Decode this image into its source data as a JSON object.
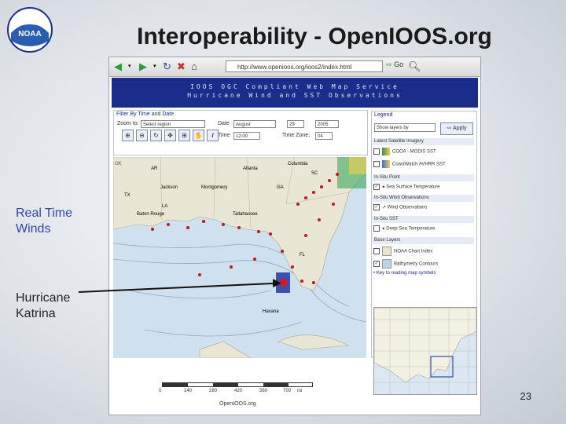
{
  "slide": {
    "title": "Interoperability - OpenIOOS.org",
    "label_winds": "Real Time Winds",
    "label_hurricane": "Hurricane Katrina",
    "slide_number": "23",
    "logo_text": "NOAA"
  },
  "browser": {
    "url": "http://www.openioos.org/ioos2/index.html",
    "go_label": "Go",
    "banner_line1": "IOOS OGC Compliant Web Map Service",
    "banner_line2": "Hurricane Wind and SST Observations",
    "filter_label": "Filter By Time and Date",
    "zoom_label": "Zoom to:",
    "zoom_value": "Select region",
    "date_label": "Date",
    "date_month": "August",
    "date_day": "29",
    "date_year": "2005",
    "time_label": "Time",
    "time_value": "12:00",
    "timezone_label": "Time Zone:",
    "timezone_value": "04",
    "legend_title": "Legend",
    "legend_select": "Show layers by",
    "apply_label": "Apply",
    "legend_sections": [
      {
        "title": "Latest Satellite Imagery",
        "items": [
          "COOA - MODIS SST",
          "CoastWatch AVHRR SST"
        ]
      },
      {
        "title": "In-Situ Point",
        "items": [
          "Sea Surface Temperature"
        ]
      },
      {
        "title": "In-Situ Wind Observations",
        "items": [
          "Wind Observations"
        ]
      },
      {
        "title": "In-Situ SST",
        "items": [
          "Deep Sea Temperature"
        ]
      },
      {
        "title": "Base Layers",
        "items": [
          "NOAA Chart Index",
          "Bathymetry Contours"
        ]
      }
    ],
    "legend_key_link": "Key to reading map symbols",
    "map_labels": [
      "AR",
      "Atlanta",
      "Columbia",
      "SC",
      "Jackson",
      "Montgomery",
      "GA",
      "TX",
      "LA",
      "Baton Rouge",
      "Tallahassee",
      "FL",
      "Havana"
    ],
    "scale_ticks": [
      "0",
      "140",
      "280",
      "420",
      "560",
      "700"
    ],
    "scale_unit": "mi",
    "footer": "OpenIOOS.org"
  },
  "colors": {
    "banner": "#1b2d8a",
    "label_blue": "#2f47a8",
    "hurricane_marker": "#e01515"
  }
}
